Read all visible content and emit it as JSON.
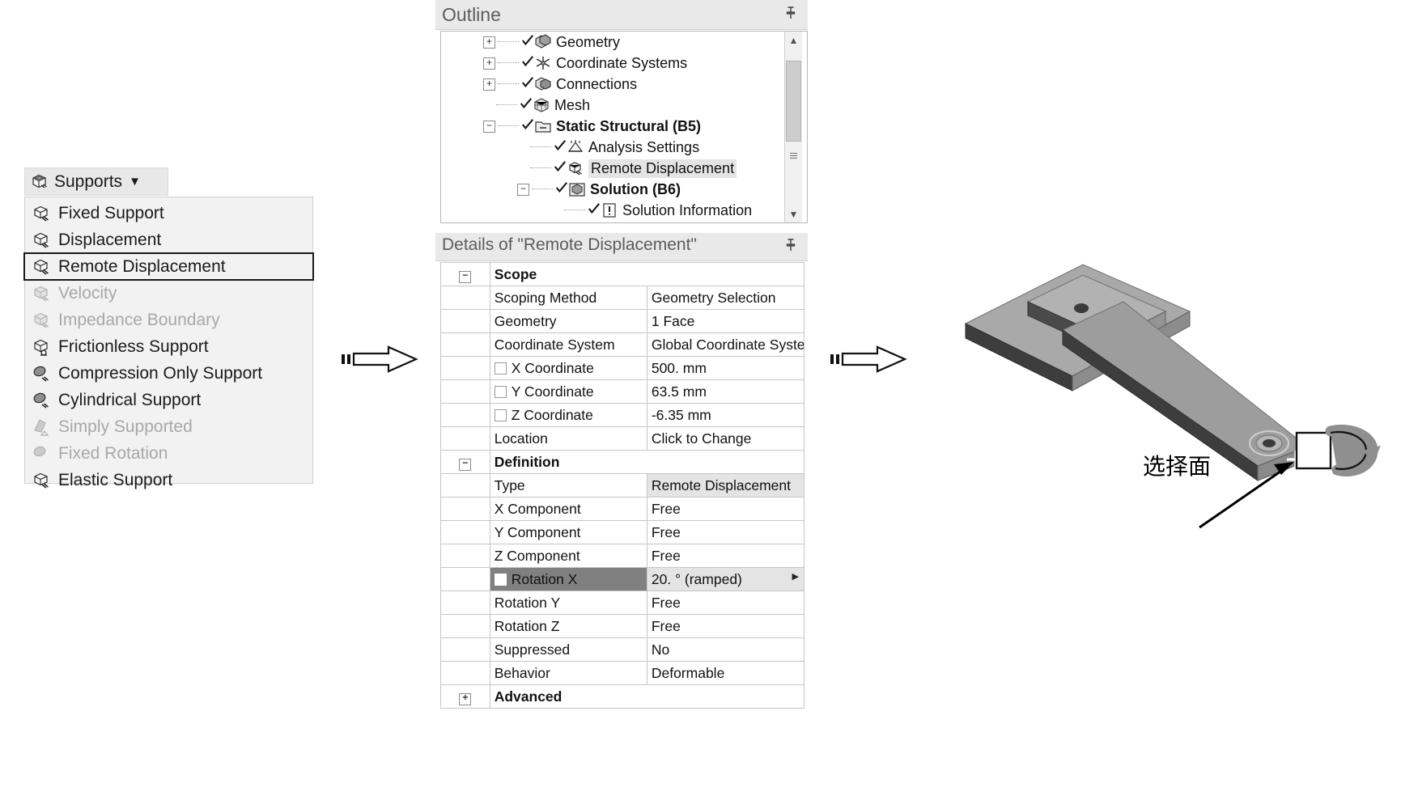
{
  "toolbar": {
    "supports_button": {
      "label": "Supports",
      "icon": "support-cube-icon",
      "caret": "▼"
    }
  },
  "supports_menu": {
    "items": [
      {
        "label": "Fixed Support",
        "icon": "fixed-support-icon",
        "enabled": true,
        "selected": false
      },
      {
        "label": "Displacement",
        "icon": "displacement-icon",
        "enabled": true,
        "selected": false
      },
      {
        "label": "Remote Displacement",
        "icon": "remote-displacement-icon",
        "enabled": true,
        "selected": true
      },
      {
        "label": "Velocity",
        "icon": "velocity-icon",
        "enabled": false,
        "selected": false
      },
      {
        "label": "Impedance Boundary",
        "icon": "impedance-boundary-icon",
        "enabled": false,
        "selected": false
      },
      {
        "label": "Frictionless Support",
        "icon": "frictionless-support-icon",
        "enabled": true,
        "selected": false
      },
      {
        "label": "Compression Only Support",
        "icon": "compression-only-icon",
        "enabled": true,
        "selected": false
      },
      {
        "label": "Cylindrical Support",
        "icon": "cylindrical-support-icon",
        "enabled": true,
        "selected": false
      },
      {
        "label": "Simply Supported",
        "icon": "simply-supported-icon",
        "enabled": false,
        "selected": false
      },
      {
        "label": "Fixed Rotation",
        "icon": "fixed-rotation-icon",
        "enabled": false,
        "selected": false
      },
      {
        "label": "Elastic Support",
        "icon": "elastic-support-icon",
        "enabled": true,
        "selected": false
      }
    ]
  },
  "outline": {
    "title": "Outline",
    "pin_glyph": "⌷",
    "rows": [
      {
        "label": "Geometry",
        "indent": 0,
        "expander": "+",
        "tick": true,
        "bold": false,
        "highlight": false,
        "icon": "geometry-icon"
      },
      {
        "label": "Coordinate Systems",
        "indent": 0,
        "expander": "+",
        "tick": true,
        "bold": false,
        "highlight": false,
        "icon": "coordinate-systems-icon"
      },
      {
        "label": "Connections",
        "indent": 0,
        "expander": "+",
        "tick": true,
        "bold": false,
        "highlight": false,
        "icon": "connections-icon"
      },
      {
        "label": "Mesh",
        "indent": 0,
        "expander": "",
        "tick": true,
        "bold": false,
        "highlight": false,
        "icon": "mesh-icon"
      },
      {
        "label": "Static Structural (B5)",
        "indent": 0,
        "expander": "−",
        "tick": true,
        "bold": true,
        "highlight": false,
        "icon": "folder-icon"
      },
      {
        "label": "Analysis Settings",
        "indent": 1,
        "expander": "",
        "tick": true,
        "bold": false,
        "highlight": false,
        "icon": "analysis-settings-icon"
      },
      {
        "label": "Remote Displacement",
        "indent": 1,
        "expander": "",
        "tick": true,
        "bold": false,
        "highlight": true,
        "icon": "remote-displacement-icon"
      },
      {
        "label": "Solution (B6)",
        "indent": 1,
        "expander": "−",
        "tick": true,
        "bold": true,
        "highlight": false,
        "icon": "solution-icon"
      },
      {
        "label": "Solution Information",
        "indent": 2,
        "expander": "",
        "tick": true,
        "bold": false,
        "highlight": false,
        "icon": "solution-information-icon"
      }
    ],
    "scrollbar": {
      "up_glyph": "▲",
      "down_glyph": "▼"
    }
  },
  "details": {
    "title": "Details of \"Remote Displacement\"",
    "pin_glyph": "⌷",
    "rows": [
      {
        "kind": "group",
        "expander": "−",
        "name": "Scope",
        "value": ""
      },
      {
        "kind": "row",
        "name": "Scoping Method",
        "value": "Geometry Selection",
        "checkbox": false,
        "selected_name": false,
        "selected_value": false
      },
      {
        "kind": "row",
        "name": "Geometry",
        "value": "1 Face",
        "checkbox": false,
        "selected_name": false,
        "selected_value": false
      },
      {
        "kind": "row",
        "name": "Coordinate System",
        "value": "Global Coordinate System",
        "checkbox": false,
        "selected_name": false,
        "selected_value": false
      },
      {
        "kind": "row",
        "name": "X Coordinate",
        "value": "500. mm",
        "checkbox": true,
        "selected_name": false,
        "selected_value": false
      },
      {
        "kind": "row",
        "name": "Y Coordinate",
        "value": "63.5 mm",
        "checkbox": true,
        "selected_name": false,
        "selected_value": false
      },
      {
        "kind": "row",
        "name": "Z Coordinate",
        "value": "-6.35 mm",
        "checkbox": true,
        "selected_name": false,
        "selected_value": false
      },
      {
        "kind": "row",
        "name": "Location",
        "value": "Click to Change",
        "checkbox": false,
        "selected_name": false,
        "selected_value": false
      },
      {
        "kind": "group",
        "expander": "−",
        "name": "Definition",
        "value": ""
      },
      {
        "kind": "row",
        "name": "Type",
        "value": "Remote Displacement",
        "checkbox": false,
        "selected_name": false,
        "selected_value": true
      },
      {
        "kind": "row",
        "name": "X Component",
        "value": "Free",
        "checkbox": false,
        "selected_name": false,
        "selected_value": false
      },
      {
        "kind": "row",
        "name": "Y Component",
        "value": "Free",
        "checkbox": false,
        "selected_name": false,
        "selected_value": false
      },
      {
        "kind": "row",
        "name": "Z Component",
        "value": "Free",
        "checkbox": false,
        "selected_name": false,
        "selected_value": false
      },
      {
        "kind": "row",
        "name": "Rotation X",
        "value": "20. °  (ramped)",
        "checkbox": true,
        "selected_name": true,
        "selected_value": true,
        "more": "▶"
      },
      {
        "kind": "row",
        "name": "Rotation Y",
        "value": "Free",
        "checkbox": false,
        "selected_name": false,
        "selected_value": false
      },
      {
        "kind": "row",
        "name": "Rotation Z",
        "value": "Free",
        "checkbox": false,
        "selected_name": false,
        "selected_value": false
      },
      {
        "kind": "row",
        "name": "Suppressed",
        "value": "No",
        "checkbox": false,
        "selected_name": false,
        "selected_value": false
      },
      {
        "kind": "row",
        "name": "Behavior",
        "value": "Deformable",
        "checkbox": false,
        "selected_name": false,
        "selected_value": false
      },
      {
        "kind": "group",
        "expander": "+",
        "name": "Advanced",
        "value": ""
      }
    ]
  },
  "viewport": {
    "annotation": "选择面",
    "cursor_icon": "rotate-cursor-icon",
    "selection_marker": "crosshair-marker"
  },
  "flow": {
    "arrow_icon": "flow-arrow-icon",
    "count": 2
  },
  "colors": {
    "panel_header": "#e9e9e9",
    "menu_bg": "#f2f2f2",
    "selection_gray": "#808080",
    "value_highlight": "#e4e4e4",
    "model_face": "#9a9a9a",
    "model_edge": "#3a3a3a",
    "text": "#111111",
    "text_disabled": "#a8a8a8"
  }
}
